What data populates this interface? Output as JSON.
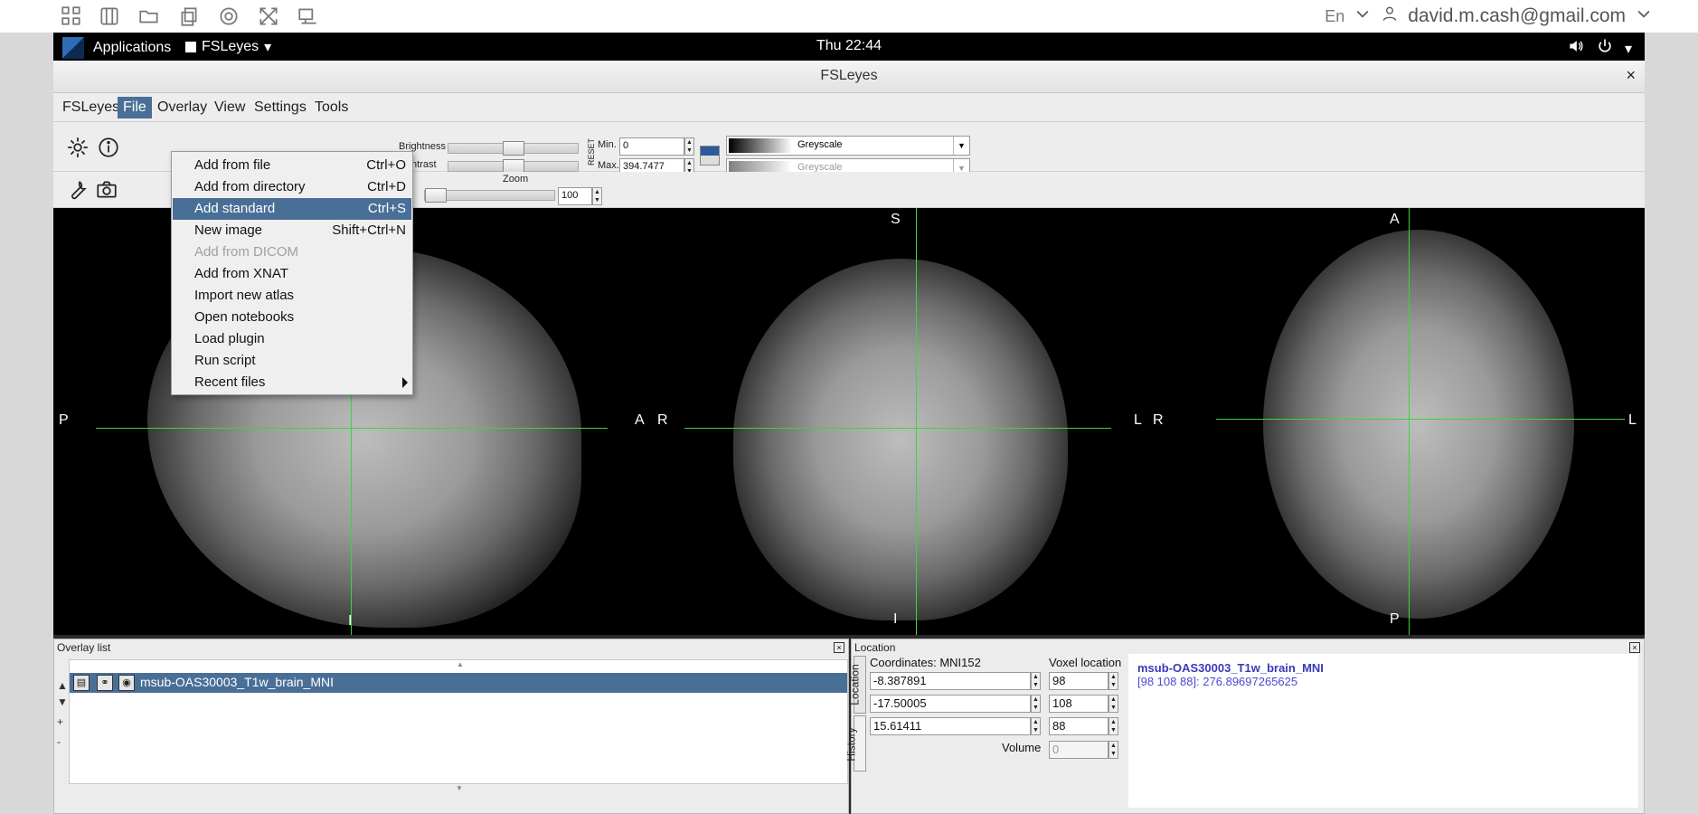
{
  "remote": {
    "lang": "En",
    "user": "david.m.cash@gmail.com"
  },
  "panel": {
    "applications": "Applications",
    "app_menu": "FSLeyes",
    "clock": "Thu 22:44"
  },
  "window": {
    "title": "FSLeyes",
    "close": "×"
  },
  "menubar": [
    "FSLeyes",
    "File",
    "Overlay",
    "View",
    "Settings",
    "Tools"
  ],
  "file_menu": [
    {
      "label": "Add from file",
      "shortcut": "Ctrl+O"
    },
    {
      "label": "Add from directory",
      "shortcut": "Ctrl+D"
    },
    {
      "label": "Add standard",
      "shortcut": "Ctrl+S"
    },
    {
      "label": "New image",
      "shortcut": "Shift+Ctrl+N"
    },
    {
      "label": "Add from DICOM",
      "shortcut": ""
    },
    {
      "label": "Add from XNAT",
      "shortcut": ""
    },
    {
      "label": "Import new atlas",
      "shortcut": ""
    },
    {
      "label": "Open notebooks",
      "shortcut": ""
    },
    {
      "label": "Load plugin",
      "shortcut": ""
    },
    {
      "label": "Run script",
      "shortcut": ""
    },
    {
      "label": "Recent files",
      "shortcut": ""
    }
  ],
  "toolbar": {
    "brightness_label": "Brightness",
    "contrast_label": "Contrast",
    "reset_label": "RESET",
    "min_label": "Min.",
    "max_label": "Max.",
    "min_value": "0",
    "max_value": "394.7477",
    "cmap1": "Greyscale",
    "cmap2": "Greyscale",
    "zoom_label": "Zoom",
    "zoom_value": "100",
    "brightness_level": 0.5,
    "contrast_level": 0.5,
    "zoom_level": 0.0
  },
  "orientation": {
    "sag_left": "P",
    "sag_right": "A",
    "cor_top": "S",
    "cor_bottom": "I",
    "cor_left": "R",
    "cor_right": "L",
    "ax_top": "A",
    "ax_bottom": "P",
    "ax_left": "R",
    "ax_right": "L",
    "sag_bottom": "I"
  },
  "overlay_list": {
    "title": "Overlay list",
    "items": [
      {
        "name": "msub-OAS30003_T1w_brain_MNI"
      }
    ]
  },
  "location": {
    "title": "Location",
    "coordinates_label": "Coordinates: MNI152",
    "voxel_label": "Voxel location",
    "coords": [
      "-8.387891",
      "-17.50005",
      "15.61411"
    ],
    "voxels": [
      "98",
      "108",
      "88"
    ],
    "volume_label": "Volume",
    "volume_value": "0",
    "tab_location": "Location",
    "tab_history": "History",
    "info_name": "msub-OAS30003_T1w_brain_MNI",
    "info_value": "[98 108 88]: 276.89697265625"
  }
}
